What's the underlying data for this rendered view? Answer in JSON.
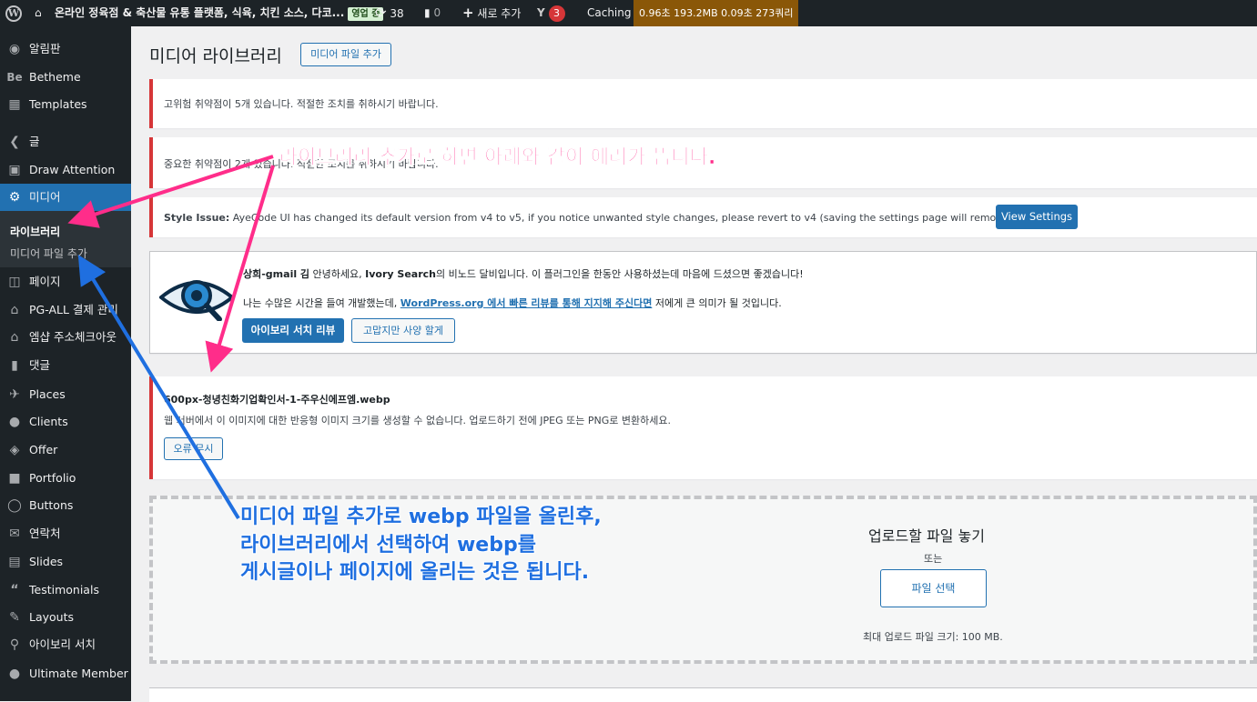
{
  "adminbar": {
    "site_name": "온라인 정육점 & 축산물 유통 플랫폼, 식육, 치킨 소스, 다코...",
    "live_badge": "영업 중",
    "updates_count": "38",
    "comments_count": "0",
    "new_label": "새로 추가",
    "yoast_count": "3",
    "caching_label": "Caching",
    "perf_stats": "0.96초  193.2MB  0.09초  273쿼리"
  },
  "sidebar": {
    "items": [
      {
        "label": "알림판",
        "icon": "dashboard-icon"
      },
      {
        "label": "Betheme",
        "icon": "betheme-icon"
      },
      {
        "label": "Templates",
        "icon": "templates-icon"
      },
      {
        "label": "글",
        "icon": "pin-icon"
      },
      {
        "label": "Draw Attention",
        "icon": "image-icon"
      },
      {
        "label": "미디어",
        "icon": "media-icon"
      },
      {
        "label": "페이지",
        "icon": "page-icon"
      },
      {
        "label": "PG-ALL 결제 관리",
        "icon": "store-icon"
      },
      {
        "label": "엠샵 주소체크아웃",
        "icon": "store-icon"
      },
      {
        "label": "댓글",
        "icon": "comment-icon"
      },
      {
        "label": "Places",
        "icon": "places-icon"
      },
      {
        "label": "Clients",
        "icon": "person-icon"
      },
      {
        "label": "Offer",
        "icon": "tag-icon"
      },
      {
        "label": "Portfolio",
        "icon": "folder-icon"
      },
      {
        "label": "Buttons",
        "icon": "circle-icon"
      },
      {
        "label": "연락처",
        "icon": "mail-icon"
      },
      {
        "label": "Slides",
        "icon": "slides-icon"
      },
      {
        "label": "Testimonials",
        "icon": "quote-icon"
      },
      {
        "label": "Layouts",
        "icon": "pencil-icon"
      },
      {
        "label": "아이보리 서치",
        "icon": "search-icon"
      },
      {
        "label": "Ultimate Member",
        "icon": "person-icon"
      }
    ],
    "submenu": [
      "라이브러리",
      "미디어 파일 추가"
    ]
  },
  "main": {
    "title": "미디어 라이브러리",
    "add_button": "미디어 파일 추가",
    "notice1": "고위험 취약점이 5개 있습니다. 적절한 조치를 취하시기 바랍니다.",
    "notice2": "중요한 취약점이 2개 있습니다. 적절한 조치를 취하시기 바랍니다.",
    "style_issue_label": "Style Issue:",
    "style_issue_text": " AyeCode UI has changed its default version from v4 to v5, if you notice unwanted style changes, please revert to v4 (saving the settings page will remove this notice)",
    "view_settings": "View Settings",
    "ivory": {
      "greeting_name": "상희-gmail 김",
      "greeting_1": " 안녕하세요, ",
      "greeting_brand": "Ivory Search",
      "greeting_2": "의 비노드 달비입니다. 이 플러그인을 한동안 사용하셨는데 마음에 드셨으면 좋겠습니다!",
      "line2_pre": "나는 수많은 시간을 들여 개발했는데, ",
      "line2_link": "WordPress.org 에서 빠른 리뷰를 통해 지지해 주신다면",
      "line2_post": " 저에게 큰 의미가 될 것입니다.",
      "review_btn": "아이보리 서치 리뷰",
      "decline_btn": "고맙지만 사양 할게"
    },
    "error": {
      "filename": "600px-청녕친화기업확인서-1-주우신에프엠.webp",
      "message": "웹 서버에서 이 이미지에 대한 반응형 이미지 크기를 생성할 수 없습니다. 업로드하기 전에 JPEG 또는 PNG로 변환하세요.",
      "dismiss": "오류 무시"
    },
    "upload": {
      "drop_label": "업로드할 파일 놓기",
      "or": "또는",
      "select_btn": "파일 선택",
      "max_size": "최대 업로드 파일 크기: 100 MB."
    }
  },
  "annotations": {
    "pink": "라이브러리 추가로 하면 아래와 같이 에러가 뜹니다.",
    "blue": [
      "미디어 파일 추가로 webp 파일을 올린후,",
      "라이브러리에서 선택하여 webp를",
      "게시글이나 페이지에 올리는 것은 됩니다."
    ],
    "pink_color": "#ff2d8a",
    "blue_color": "#1f6fe0"
  }
}
